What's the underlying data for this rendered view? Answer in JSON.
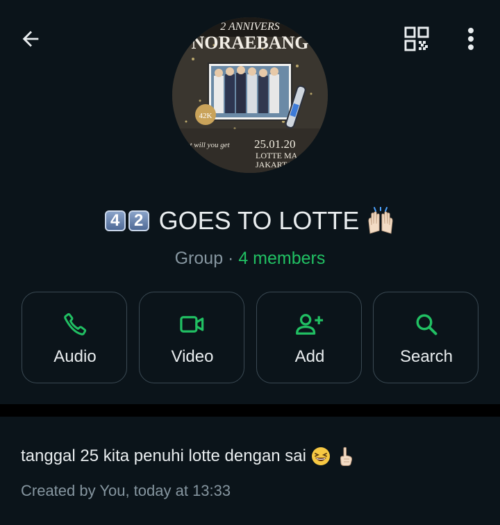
{
  "header": {
    "back_icon": "arrow-left-icon",
    "qr_icon": "qr-code-icon",
    "menu_icon": "more-vertical-icon"
  },
  "avatar": {
    "line1": "2 ANNIVERS",
    "line2": "NORAEBANG",
    "badge": "42K",
    "date": "25.01.20",
    "venue1": "LOTTE MA",
    "venue2": "JAKARTA",
    "slogan": "at will you get"
  },
  "group": {
    "keycap_1": "4",
    "keycap_2": "2",
    "name": "GOES TO LOTTE",
    "type_label": "Group",
    "separator": "·",
    "members_label": "4 members"
  },
  "actions": [
    {
      "label": "Audio",
      "icon": "phone-icon"
    },
    {
      "label": "Video",
      "icon": "video-camera-icon"
    },
    {
      "label": "Add",
      "icon": "add-person-icon"
    },
    {
      "label": "Search",
      "icon": "search-icon"
    }
  ],
  "description": {
    "text": "tanggal 25 kita penuhi lotte dengan sai",
    "created": "Created by You, today at 13:33"
  },
  "colors": {
    "background": "#0b141a",
    "accent_green": "#21c063",
    "text_primary": "#e9edef",
    "text_secondary": "#8696a0",
    "border": "#3b4a54"
  }
}
